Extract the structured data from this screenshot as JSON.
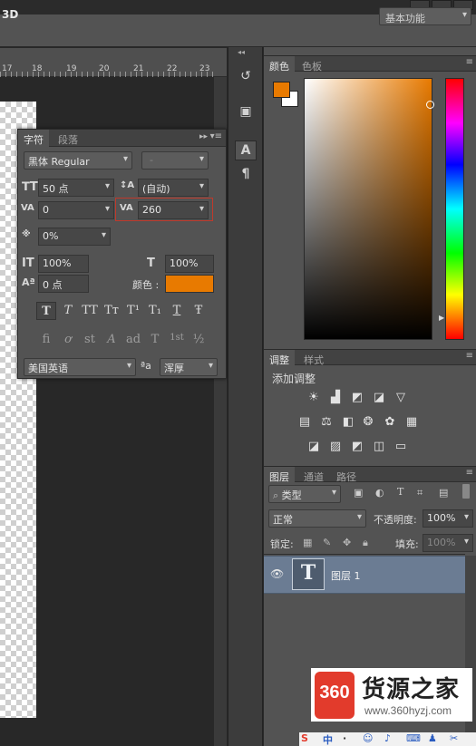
{
  "topbar": {
    "mode_label": "3D",
    "workspace": "基本功能"
  },
  "ruler": {
    "ticks": [
      "17",
      "18",
      "19",
      "20",
      "21",
      "22",
      "23"
    ]
  },
  "character_panel": {
    "tabs": [
      "字符",
      "段落"
    ],
    "font_family": "黑体 Regular",
    "font_style": "-",
    "font_size": "50 点",
    "leading": "(自动)",
    "kerning": "0",
    "tracking": "260",
    "tsume": "0%",
    "vertical_scale": "100%",
    "horizontal_scale": "100%",
    "baseline_shift": "0 点",
    "color_label": "颜色 :",
    "color": "#e87a00",
    "style_buttons": [
      "T",
      "T",
      "TT",
      "Tт",
      "T¹",
      "T₁",
      "T",
      "Ŧ"
    ],
    "opentype_buttons": [
      "fi",
      "ơ",
      "st",
      "A",
      "ad",
      "T",
      "1st",
      "½"
    ],
    "language": "美国英语",
    "aa_label": "ªa",
    "antialias": "浑厚"
  },
  "color_panel": {
    "tabs": [
      "颜色",
      "色板"
    ],
    "foreground": "#e87a00",
    "background": "#ffffff"
  },
  "adjustments_panel": {
    "tabs": [
      "调整",
      "样式"
    ],
    "title": "添加调整",
    "row1": [
      "☀",
      "▟",
      "◩",
      "◪",
      "▽"
    ],
    "row2": [
      "▤",
      "⚖",
      "◧",
      "❂",
      "✿",
      "▦"
    ],
    "row3": [
      "◪",
      "▨",
      "◩",
      "◫",
      "▭"
    ]
  },
  "layers_panel": {
    "tabs": [
      "图层",
      "通道",
      "路径"
    ],
    "filter": "类型",
    "blend_mode": "正常",
    "opacity_label": "不透明度:",
    "opacity": "100%",
    "lock_label": "锁定:",
    "fill_label": "填充:",
    "fill": "100%",
    "layer_name": "图层 1",
    "layer_thumb": "T"
  },
  "watermark": {
    "logo": "360",
    "title": "货源之家",
    "url": "www.360hyzj.com"
  },
  "taskbar": {
    "items": [
      "S",
      "中",
      "·",
      "☺",
      "♪",
      "⌨",
      "♟",
      "✂"
    ]
  }
}
